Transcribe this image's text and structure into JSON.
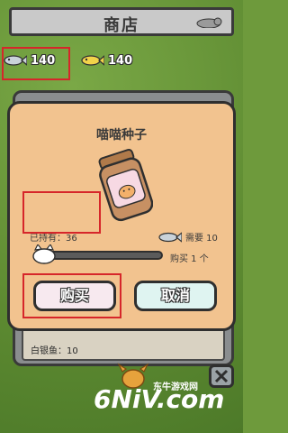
{
  "header": {
    "title": "商店"
  },
  "currency": {
    "silver_fish": {
      "icon": "silver-fish-icon",
      "amount": "140"
    },
    "gold_fish": {
      "icon": "gold-fish-icon",
      "amount": "140"
    }
  },
  "background_list": {
    "row_label": "白银鱼：10"
  },
  "dialog": {
    "title": "喵喵种子",
    "owned_label": "已持有：36",
    "price_label": "需要 10",
    "quantity_label": "购买 1 个",
    "buy_label": "购买",
    "cancel_label": "取消"
  },
  "watermark": {
    "logo": "6NiV.com",
    "brand": "东牛游戏网"
  },
  "colors": {
    "dialog_bg": "#f2c38f",
    "highlight": "#d6262a",
    "buy_button": "#f4d4e2",
    "cancel_button": "#bfe7e1",
    "grass": "#5d8a31"
  }
}
